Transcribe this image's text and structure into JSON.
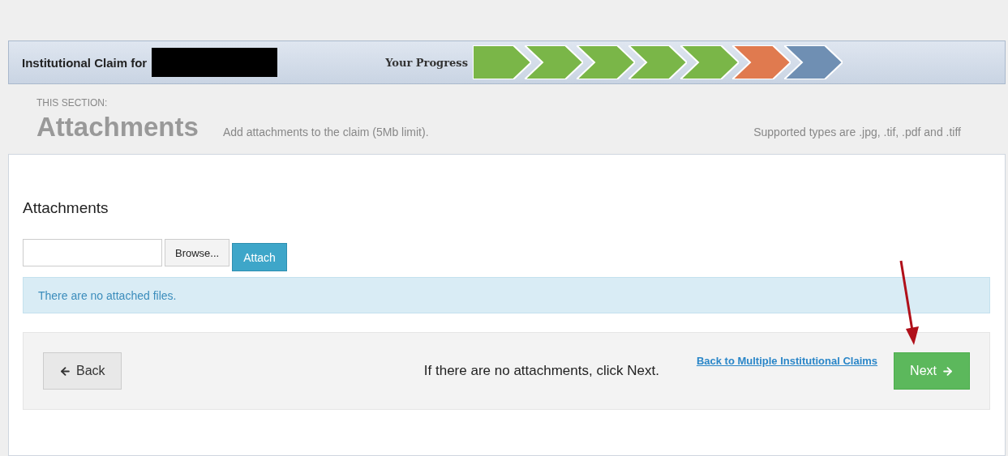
{
  "header": {
    "title": "Institutional Claim for",
    "progress_label": "Your Progress",
    "progress_steps": [
      {
        "kind": "done"
      },
      {
        "kind": "done"
      },
      {
        "kind": "done"
      },
      {
        "kind": "done"
      },
      {
        "kind": "done"
      },
      {
        "kind": "current"
      },
      {
        "kind": "pending"
      }
    ]
  },
  "section": {
    "eyebrow": "THIS SECTION:",
    "title": "Attachments",
    "description": "Add attachments to the claim (5Mb limit).",
    "note": "Supported types are .jpg, .tif, .pdf and .tiff"
  },
  "panel": {
    "heading": "Attachments",
    "browse_button": "Browse...",
    "attach_button": "Attach",
    "info_message": "There are no attached files."
  },
  "footer": {
    "back_button": "Back",
    "hint": "If there are no attachments, click Next.",
    "link": "Back to Multiple Institutional Claims",
    "next_button": "Next"
  }
}
